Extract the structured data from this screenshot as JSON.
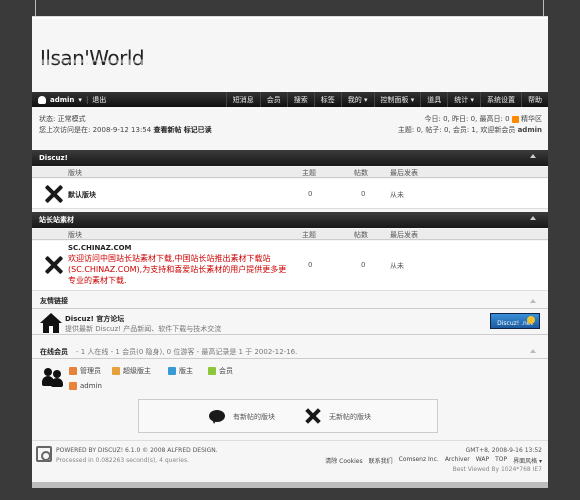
{
  "site": {
    "logo_text": "Ilsan'World"
  },
  "navbar": {
    "username": "admin",
    "logout": "退出",
    "menu": [
      "短消息",
      "会员",
      "搜索",
      "标签",
      "我的 ▾",
      "控制面板 ▾",
      "道具",
      "统计 ▾",
      "系统设置",
      "帮助"
    ]
  },
  "status": {
    "line1_label": "状态:",
    "line1_value": "正常模式",
    "line2": "您上次访问是在: 2008-9-12 13:54",
    "line2_link1": "查看新帖",
    "line2_link2": "标记已读"
  },
  "stats": {
    "line1": "今日: 0, 昨日: 0, 最高日: 0",
    "line1_link": "精华区",
    "line2": "主题: 0, 帖子: 0, 会员: 1, 欢迎新会员",
    "line2_user": "admin"
  },
  "columns": {
    "forum": "版块",
    "topics": "主题",
    "posts": "帖数",
    "last": "最后发表"
  },
  "categories": [
    {
      "title": "Discuz!",
      "forum_name": "默认版块",
      "topics": "0",
      "posts": "0",
      "last": "从未"
    },
    {
      "title": "站长站素材",
      "forum_name": "SC.CHINAZ.COM",
      "description": "欢迎访问中国站长站素材下载,中国站长站推出素材下载站(SC.CHINAZ.COM),为支持和喜爱站长素材的用户提供更多更专业的素材下载.",
      "topics": "0",
      "posts": "0",
      "last": "从未"
    }
  ],
  "links": {
    "title": "友情链接",
    "item_title": "Discuz! 官方论坛",
    "item_desc": "提供最新 Discuz! 产品新闻、软件下载与技术交流",
    "badge_text": "Discuz! .net"
  },
  "online": {
    "title": "在线会员",
    "summary": "- 1 人在线 - 1 会员(0 隐身), 0 位游客 - 最高记录是 1 于 2002-12-16.",
    "legend": [
      {
        "label": "管理员",
        "color": "#e8843a"
      },
      {
        "label": "超级版主",
        "color": "#e8a03a"
      },
      {
        "label": "版主",
        "color": "#3a9ad8"
      },
      {
        "label": "会员",
        "color": "#8cc63a"
      }
    ],
    "user": "admin"
  },
  "icon_legend": {
    "new": "有新帖的版块",
    "none": "无新帖的版块"
  },
  "footer": {
    "powered": "POWERED BY DISCUZ! 6.1.0 © 2008 ALFRED DESIGN.",
    "processed": "Processed in 0.082263 second(s), 4 queries.",
    "time": "GMT+8, 2008-9-16 13:52",
    "links": [
      "清除 Cookies",
      "联系我们",
      "Comsenz Inc.",
      "Archiver",
      "WAP",
      "TOP",
      "界面风格 ▾"
    ],
    "best_viewed": "Best Viewed By 1024*768 IE7"
  }
}
